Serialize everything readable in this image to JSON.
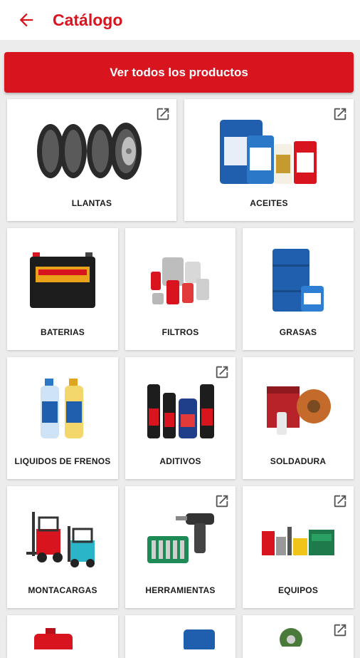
{
  "header": {
    "title": "Catálogo",
    "back_icon": "arrow-left-icon"
  },
  "cta": {
    "label": "Ver todos los productos"
  },
  "colors": {
    "brand": "#d8141f",
    "background": "#ececec"
  },
  "categories": [
    {
      "label": "LLANTAS",
      "external_link": true
    },
    {
      "label": "ACEITES",
      "external_link": true
    },
    {
      "label": "BATERIAS",
      "external_link": false
    },
    {
      "label": "FILTROS",
      "external_link": false
    },
    {
      "label": "GRASAS",
      "external_link": false
    },
    {
      "label": "LIQUIDOS DE FRENOS",
      "external_link": false
    },
    {
      "label": "ADITIVOS",
      "external_link": true
    },
    {
      "label": "SOLDADURA",
      "external_link": false
    },
    {
      "label": "MONTACARGAS",
      "external_link": false
    },
    {
      "label": "HERRAMIENTAS",
      "external_link": true
    },
    {
      "label": "EQUIPOS",
      "external_link": true
    },
    {
      "label": "",
      "external_link": false
    },
    {
      "label": "",
      "external_link": false
    },
    {
      "label": "",
      "external_link": true
    }
  ]
}
